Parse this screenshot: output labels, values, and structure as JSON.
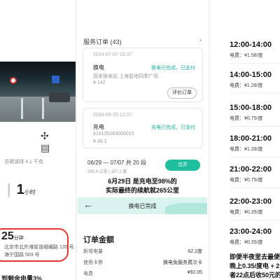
{
  "left": {
    "caption": "· 总碳减排 4.1 千克",
    "hour_value": "1",
    "hour_unit": "小时",
    "dest_minutes": "25",
    "dest_unit": "分钟",
    "dest_line1": "北京市北外滩街道峨嵋路 135 号...",
    "dest_line2": "海宁国路 503 号",
    "bottom_text": "到剩余电量3%"
  },
  "orders": {
    "header": "服务订单 (43)",
    "cards": [
      {
        "time": "2024-07-07 19:37",
        "title": "换电",
        "status": "换电已完成，已支付",
        "subtitle": "蔚来换电站 上海复地四季广场",
        "price": "¥ 142",
        "button": "评价订单"
      },
      {
        "time": "2024-06-29 12:07",
        "title": "充电",
        "status": "充电已完成，已支付",
        "subtitle": "610135263000010",
        "price": "¥ 49.3"
      }
    ],
    "summary": "06/29 — 07/07 共 20 段",
    "summary_sub": "285.4 公里 | 197.2 度",
    "merge_button": "合并",
    "note_line1": "6月29日 是充电至98%的",
    "note_line2": "实际最终的续航就265公里",
    "banner_title": "换电已完成",
    "amount_title": "订单金额",
    "amount_rows": [
      {
        "label": "新增电量",
        "value": "62.2度"
      },
      {
        "label": "使用卡券",
        "value": "换电免服务费次卡"
      },
      {
        "label": "电费",
        "value": "¥92.05"
      }
    ]
  },
  "tariff": {
    "price_prefix": "电费：",
    "slots": [
      {
        "time": "12:00-14:00",
        "price": "¥1.58/度"
      },
      {
        "time": "14:00-15:00",
        "price": "¥1.28/度"
      },
      {
        "time": "15:00-18:00",
        "price": "¥0.75/度"
      },
      {
        "time": "18:00-21:00",
        "price": "¥1.28/度"
      },
      {
        "time": "21:00-22:00",
        "price": "¥0.75/度"
      },
      {
        "time": "22:00-23:00",
        "price": "¥0.35/度"
      },
      {
        "time": "23:00-24:00",
        "price": "¥0.35/度"
      }
    ],
    "note_lines": [
      "即便半夜里去最便宜",
      "晚上0.35/度电 + 2",
      "者22点后收50元的"
    ]
  }
}
